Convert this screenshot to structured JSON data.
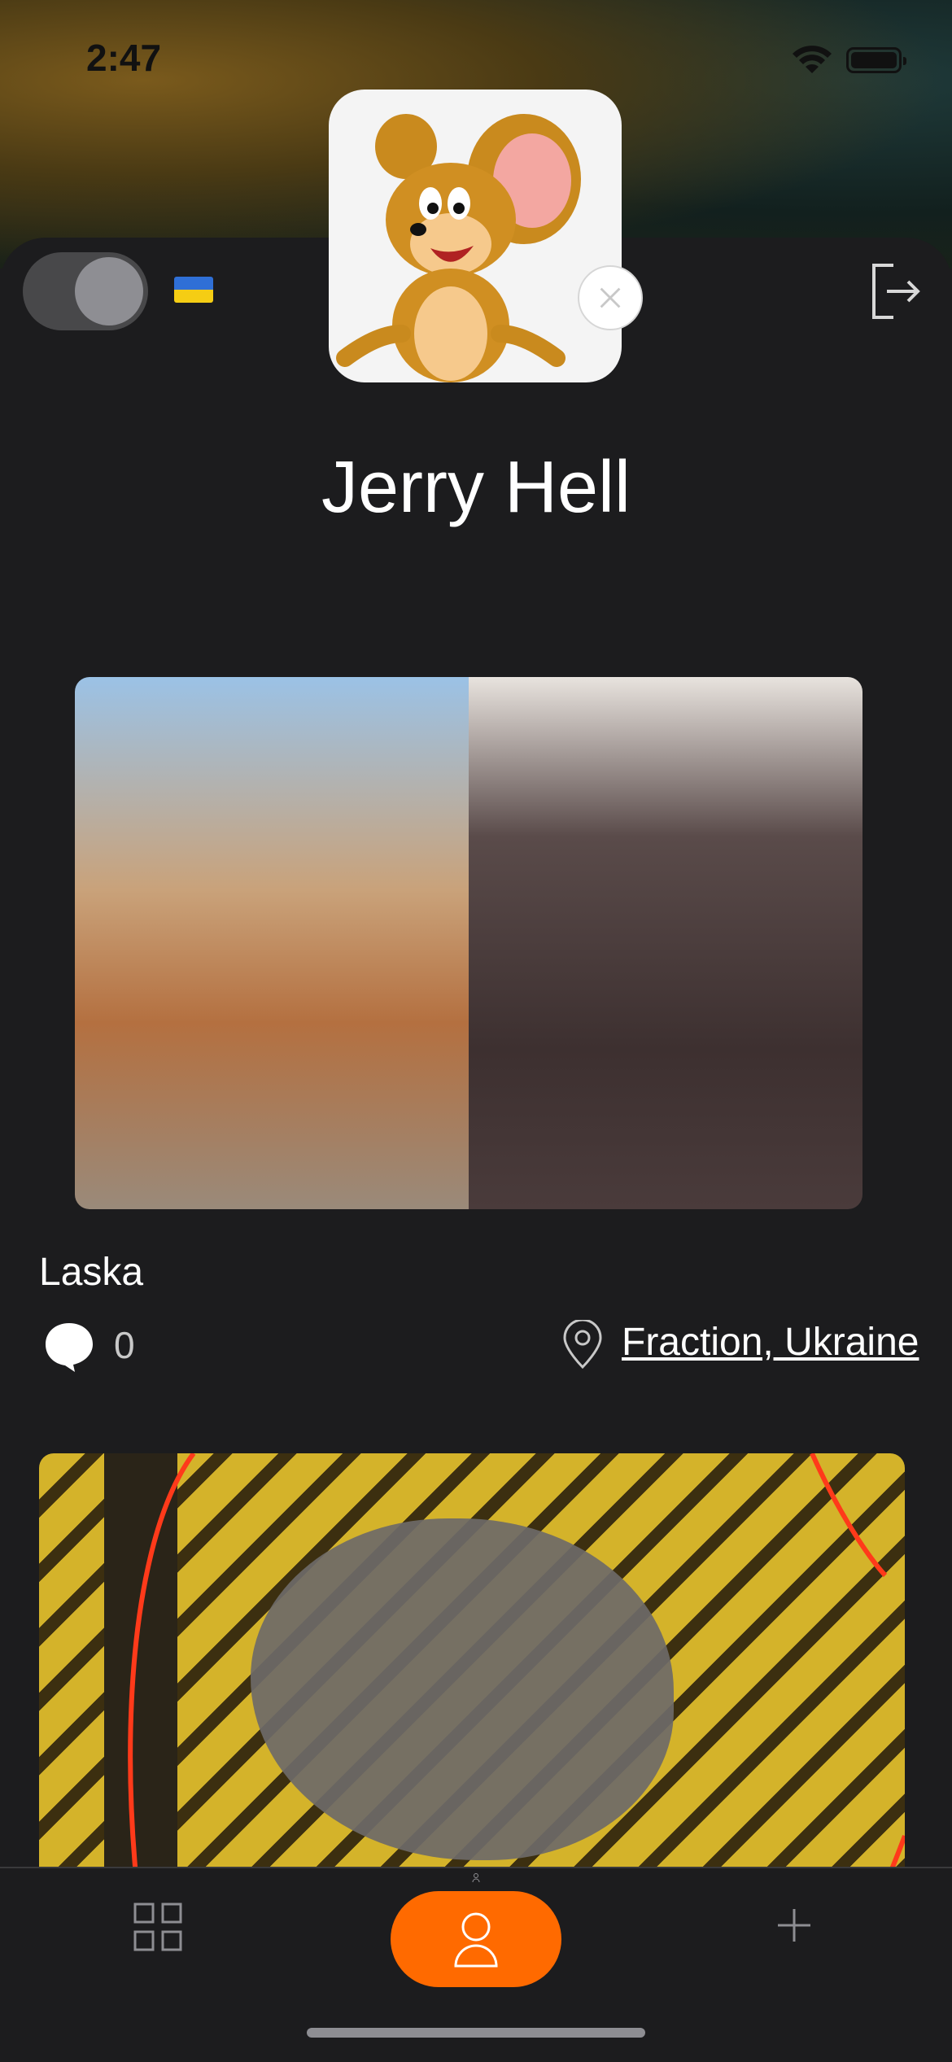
{
  "status_bar": {
    "time": "2:47",
    "wifi_icon": "wifi-icon",
    "battery_icon": "battery-icon"
  },
  "header": {
    "toggle_state": "on",
    "flag_icon": "ukraine-flag-icon",
    "logout_icon": "logout-icon",
    "avatar_icon": "avatar-image",
    "avatar_remove_icon": "close-icon"
  },
  "profile": {
    "username": "Jerry Hell"
  },
  "posts": [
    {
      "title": "Laska",
      "comment_count": "0",
      "location": "Fraction, Ukraine"
    }
  ],
  "bottom_nav": {
    "items": [
      {
        "icon": "grid-icon"
      },
      {
        "icon": "profile-icon",
        "active": true
      },
      {
        "icon": "plus-icon"
      }
    ],
    "accent": "#ff6a00"
  }
}
